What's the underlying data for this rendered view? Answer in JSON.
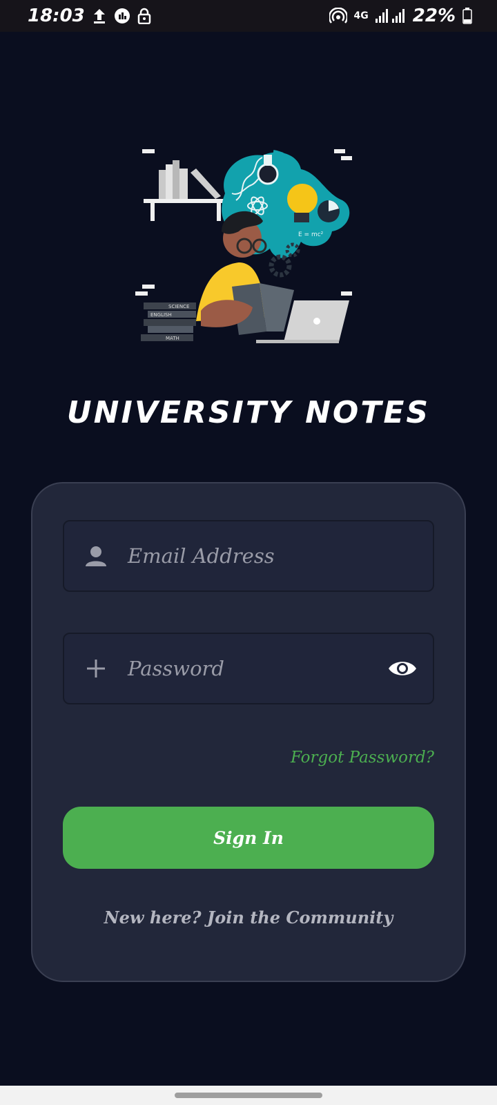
{
  "status_bar": {
    "time": "18:03",
    "network": "4G",
    "battery": "22%",
    "icons": [
      "upload-icon",
      "data-saver-icon",
      "lock-icon",
      "hotspot-icon",
      "signal-icon",
      "battery-icon"
    ]
  },
  "app": {
    "title": "UNIVERSITY NOTES",
    "illustration_book_labels": [
      "SCIENCE",
      "ENGLISH",
      "MATH"
    ],
    "illustration_formula": "E = mc²"
  },
  "login_form": {
    "email_placeholder": "Email Address",
    "password_placeholder": "Password",
    "forgot_password": "Forgot Password?",
    "sign_in_label": "Sign In",
    "join_text": "New here? Join the Community"
  },
  "colors": {
    "background": "#0a0e1f",
    "card": "#22273a",
    "accent": "#4caf50"
  }
}
